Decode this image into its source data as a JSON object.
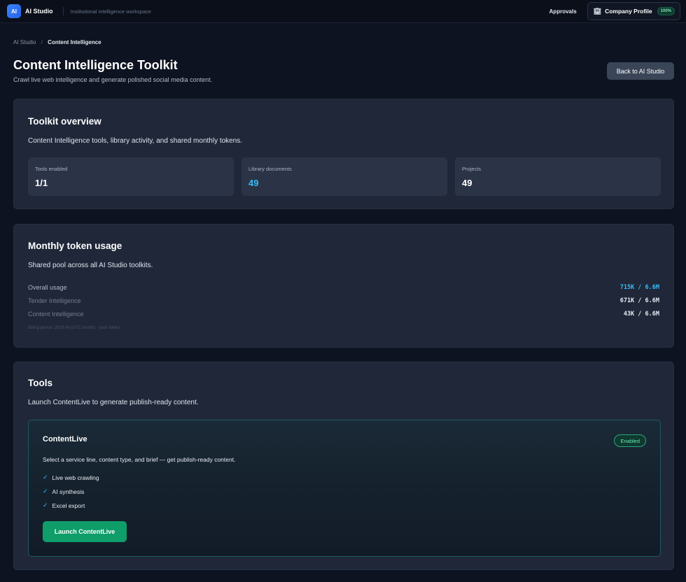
{
  "topbar": {
    "logo_text": "AI",
    "brand": "AI Studio",
    "subtitle": "Institutional intelligence workspace",
    "approvals": "Approvals",
    "company_profile": "Company Profile",
    "company_profile_percent": "100%",
    "company_icon": "building-icon"
  },
  "breadcrumb": {
    "root": "AI Studio",
    "separator": "/",
    "current": "Content Intelligence"
  },
  "header": {
    "title": "Content Intelligence Toolkit",
    "subtitle": "Crawl live web intelligence and generate polished social media content.",
    "back_button": "Back to AI Studio"
  },
  "overview": {
    "title": "Toolkit overview",
    "description": "Content Intelligence tools, library activity, and shared monthly tokens.",
    "stats": [
      {
        "label": "Tools enabled",
        "value": "1/1"
      },
      {
        "label": "Library documents",
        "value": "49"
      },
      {
        "label": "Projects",
        "value": "49"
      }
    ]
  },
  "usage": {
    "title": "Monthly token usage",
    "description": "Shared pool across all AI Studio toolkits.",
    "rows": [
      {
        "label": "Overall usage",
        "value": "715K / 6.6M"
      },
      {
        "label": "Tender Intelligence",
        "value": "671K / 6.6M"
      },
      {
        "label": "Content Intelligence",
        "value": "43K / 6.6M"
      }
    ],
    "billing_note": "Billing period: 2026-06 (UTC month) · your tokens"
  },
  "tools": {
    "title": "Tools",
    "description": "Launch ContentLive to generate publish-ready content.",
    "tool": {
      "name": "ContentLive",
      "status": "Enabled",
      "description": "Select a service line, content type, and brief — get publish-ready content.",
      "check_icon": "check-icon",
      "features": [
        "Live web crawling",
        "AI synthesis",
        "Excel export"
      ],
      "launch_button": "Launch ContentLive"
    }
  },
  "colors": {
    "background": "#0d1320",
    "card": "#1f2739",
    "accent": "#38bdf8",
    "success": "#0f9d6a"
  }
}
